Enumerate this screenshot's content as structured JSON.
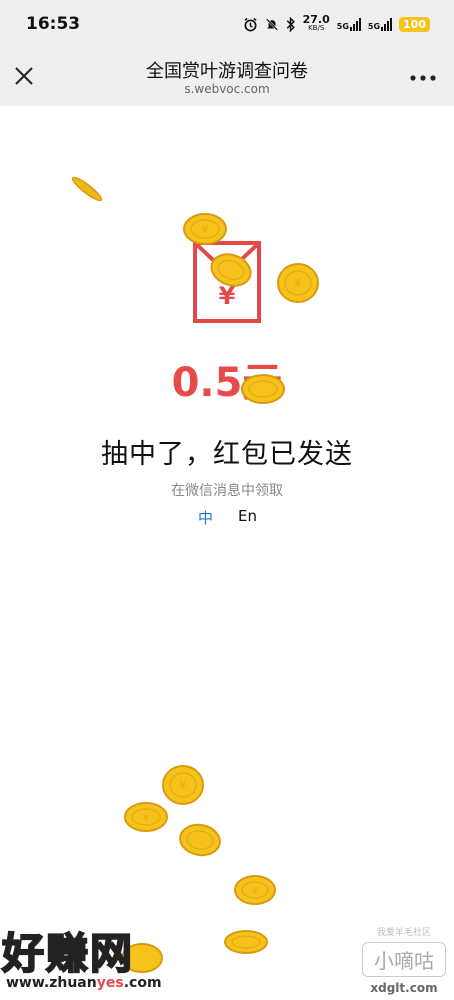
{
  "status_bar": {
    "time": "16:53",
    "net_speed_value": "27.0",
    "net_speed_unit": "KB/S",
    "signal_labels": [
      "5G",
      "5G"
    ],
    "battery": "100"
  },
  "nav": {
    "title": "全国赏叶游调查问卷",
    "subtitle": "s.webvoc.com",
    "close_icon": "close-icon",
    "more_icon": "more-icon"
  },
  "result": {
    "envelope_symbol": "¥",
    "amount": "0.5元",
    "message": "抽中了，红包已发送",
    "hint": "在微信消息中领取"
  },
  "language": {
    "zh": "中",
    "en": "En"
  },
  "watermarks": {
    "left_text": "好赚网",
    "left_url_a": "www.zhuan",
    "left_url_b": "yes",
    "left_url_c": ".com",
    "right_small": "我爱羊毛社区",
    "right_brand": "小嘀咕",
    "right_domain": "xdglt.com"
  },
  "colors": {
    "accent_red": "#e84a4a",
    "link_blue": "#1a78d2",
    "coin_gold": "#f6c21c"
  }
}
